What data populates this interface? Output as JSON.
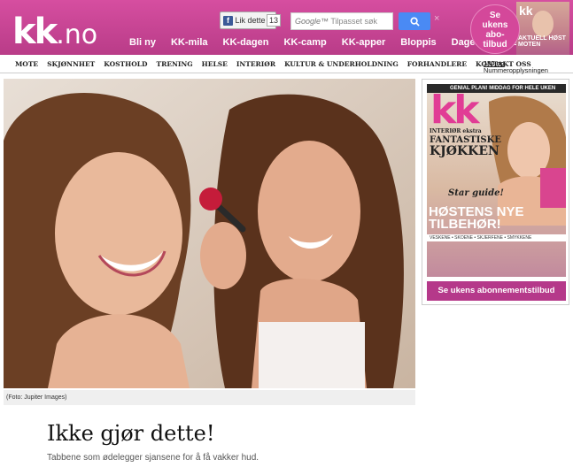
{
  "header": {
    "logo_main": "kk",
    "logo_suffix": ".no",
    "like_label": "Lik dette",
    "like_count": "13",
    "search_brand": "Google™",
    "search_placeholder": "Tilpasset søk",
    "close_glyph": "×",
    "nav": [
      "Bli ny",
      "KK-mila",
      "KK-dagen",
      "KK-camp",
      "KK-apper",
      "Bloppis",
      "Dagens sunne"
    ],
    "badge_lines": [
      "Se",
      "ukens",
      "abo-",
      "tilbud"
    ],
    "thumb_logo": "kk",
    "thumb_text": "AKTUELL HØST MOTEN"
  },
  "subnav": {
    "items": [
      "MOTE",
      "SKJØNNHET",
      "KOSTHOLD",
      "TRENING",
      "HELSE",
      "INTERIØR",
      "KULTUR & UNDERHOLDNING",
      "FORHANDLERE",
      "KONTAKT OSS"
    ],
    "link_180": "180.no",
    "nummer": "Nummeropplysningen"
  },
  "hero": {
    "caption": "(Foto: Jupiter Images)"
  },
  "promo": {
    "cover_top": "GENIAL PLAN! MIDDAG FOR HELE UKEN",
    "cover_logo": "kk",
    "cover_lines": [
      "INTERIØR ekstra",
      "FANTASTISKE",
      "KJØKKEN",
      "Star guide!"
    ],
    "cover_headline": "HØSTENS NYE TILBEHØR!",
    "cover_stripe": "VESKENE • SKOENE • SKJERFENE • SMYKKENE",
    "button_label": "Se ukens abonnementstilbud"
  },
  "article": {
    "title": "Ikke gjør dette!",
    "lead": "Tabbene som ødelegger sjansene for å få vakker hud."
  },
  "colors": {
    "brand_pink": "#c2438f",
    "button_pink": "#b5398a",
    "search_blue": "#4a8af4"
  }
}
